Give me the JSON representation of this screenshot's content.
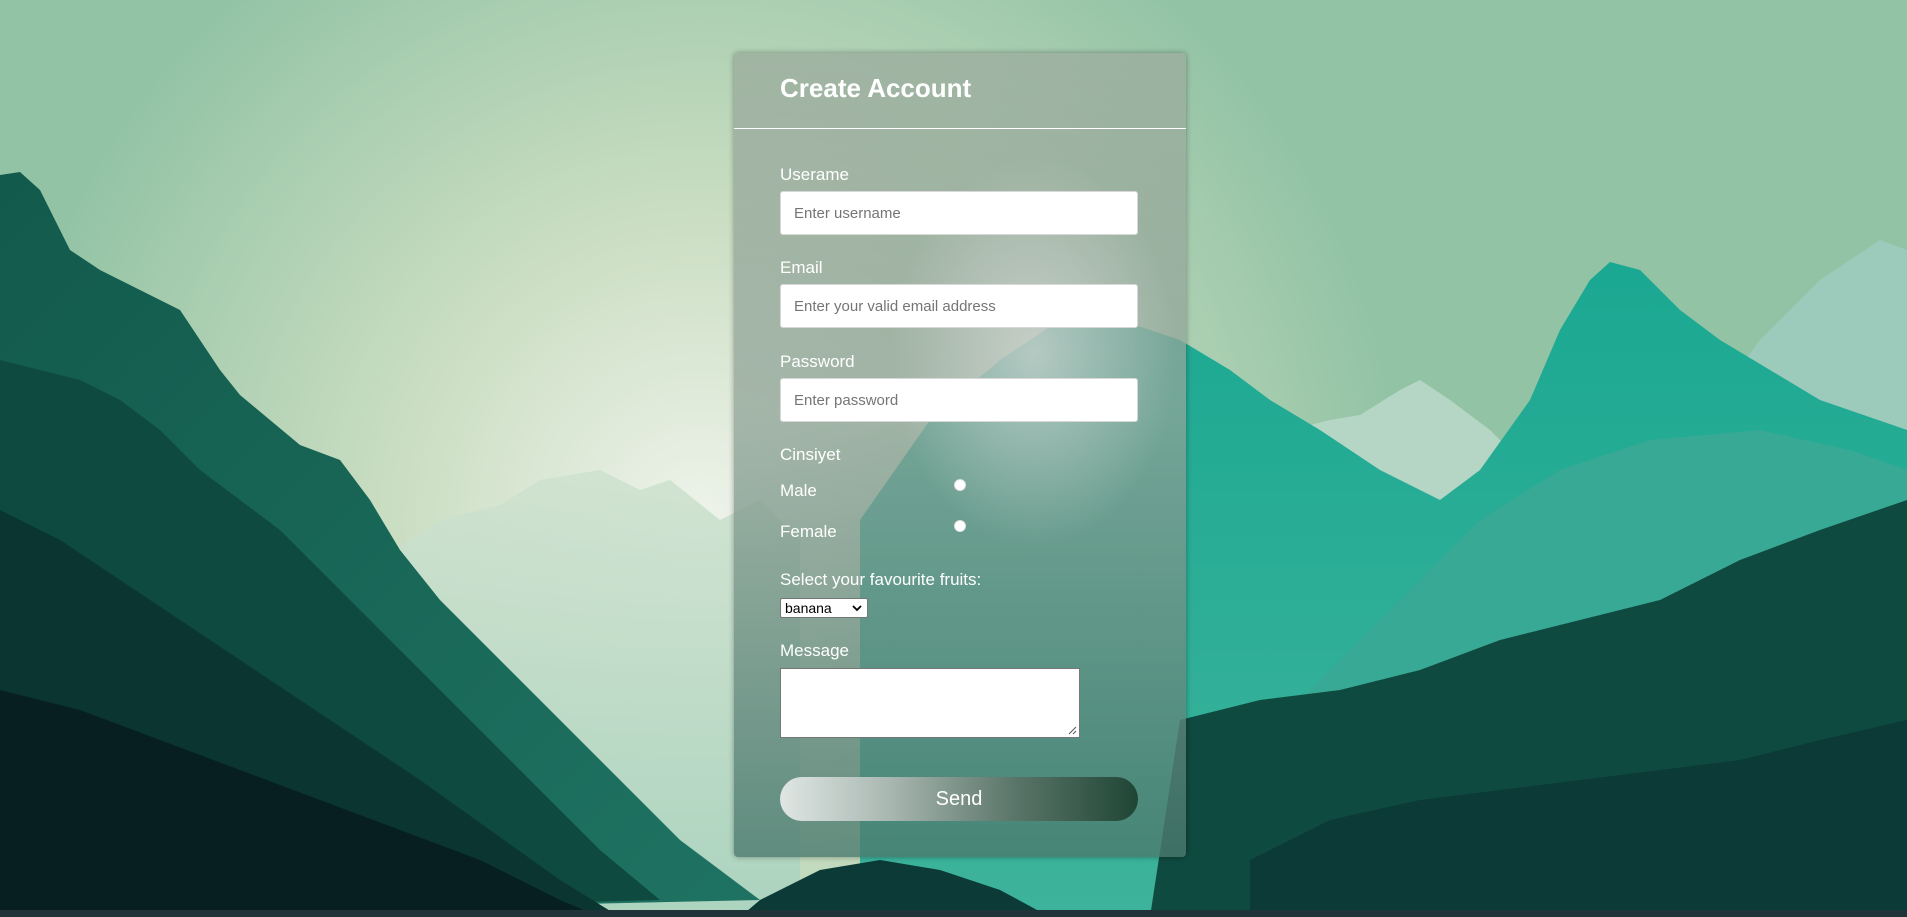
{
  "form": {
    "title": "Create Account",
    "username": {
      "label": "Userame",
      "placeholder": "Enter username",
      "value": ""
    },
    "email": {
      "label": "Email",
      "placeholder": "Enter your valid email address",
      "value": ""
    },
    "password": {
      "label": "Password",
      "placeholder": "Enter password",
      "value": ""
    },
    "gender": {
      "label": "Cinsiyet",
      "options": [
        {
          "label": "Male",
          "selected": false
        },
        {
          "label": "Female",
          "selected": false
        }
      ]
    },
    "fruits": {
      "label": "Select your favourite fruits:",
      "selected": "banana"
    },
    "message": {
      "label": "Message",
      "value": ""
    },
    "submit_label": "Send"
  },
  "colors": {
    "sky_top": "#9ec8ab",
    "sky_glow": "#eaf1e4",
    "mountain_dark": "#0f3b35",
    "mountain_mid": "#1e6e5e",
    "mountain_teal": "#2fa590",
    "bottom_strip": "#1f3338"
  }
}
